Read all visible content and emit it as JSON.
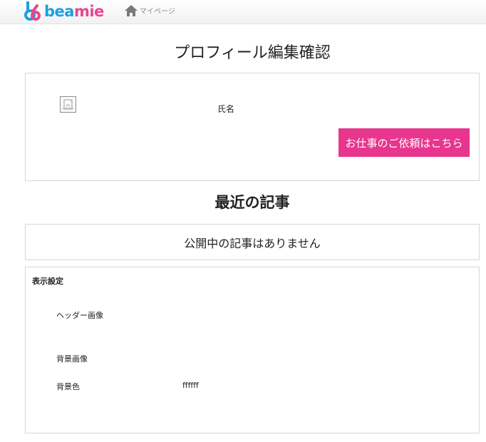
{
  "header": {
    "logo_text_blue": "bea",
    "logo_text_pink": "mie",
    "nav_mypage": "マイページ"
  },
  "main": {
    "title": "プロフィール編集確認",
    "profile": {
      "name_label": "氏名",
      "request_button": "お仕事のご依頼はこちら"
    },
    "recent_articles": {
      "title": "最近の記事",
      "empty_message": "公開中の記事はありません"
    },
    "display_settings": {
      "heading": "表示設定",
      "header_image_label": "ヘッダー画像",
      "background_image_label": "背景画像",
      "background_color_label": "背景色",
      "background_color_value": "ffffff"
    }
  },
  "colors": {
    "brand_blue": "#1f9fe0",
    "brand_pink": "#e8468f",
    "button_pink": "#e8358d"
  }
}
